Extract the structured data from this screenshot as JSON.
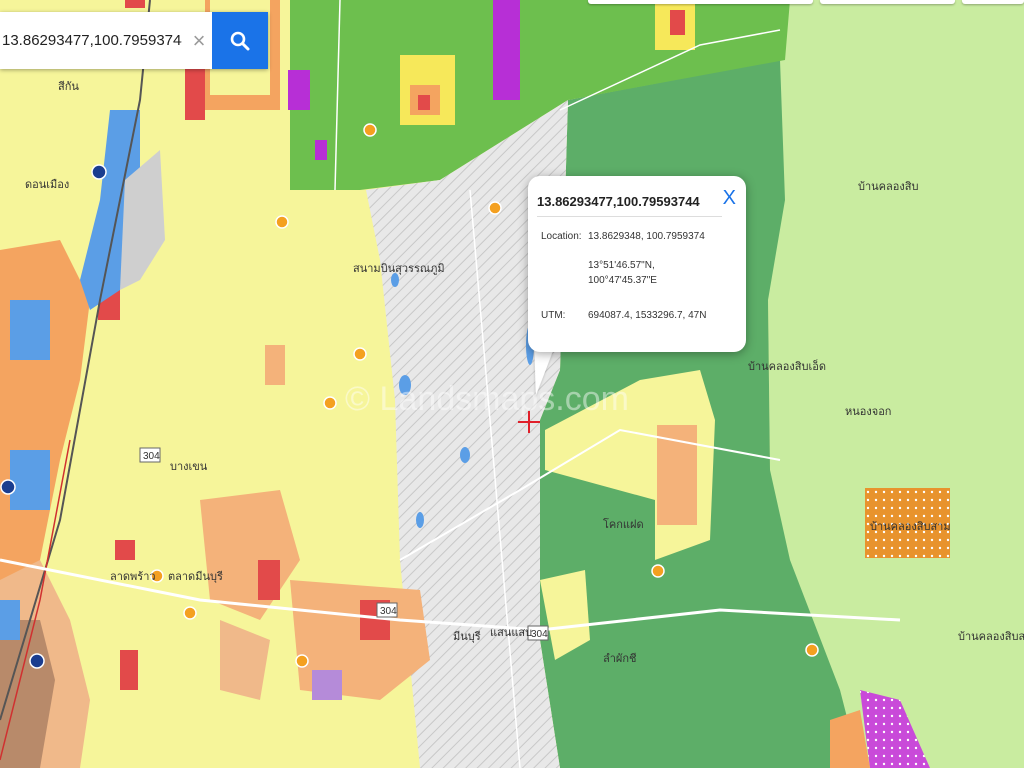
{
  "search": {
    "value": "13.86293477,100.79593744",
    "clear_glyph": "×",
    "search_icon": "search-icon"
  },
  "popup": {
    "title": "13.86293477,100.79593744",
    "close_glyph": "X",
    "location_label": "Location:",
    "location_decimal": "13.8629348, 100.7959374",
    "dms_lat": "13°51'46.57\"N,",
    "dms_lon": "100°47'45.37\"E",
    "utm_label": "UTM:",
    "utm_value": "694087.4, 1533296.7, 47N"
  },
  "map_labels": {
    "place_1": "สีกัน",
    "place_2": "ดอนเมือง",
    "place_3": "สนามบินสุวรรณภูมิ",
    "place_4": "โคกแฝด",
    "place_5": "ลาดพร้าว",
    "place_6": "บางเขน",
    "place_7": "มีนบุรี",
    "place_8": "แสนแสบ",
    "place_9": "หนองจอก",
    "place_10": "ลำผักชี",
    "place_11": "ตลาดมีนบุรี",
    "place_12": "บ้านคลองสิบ",
    "place_13": "บ้านคลองสิบเอ็ด",
    "place_14": "บ้านคลองสิบสาม",
    "place_15": "บ้านคลองสิบสาม",
    "road_304a": "304",
    "road_304b": "304",
    "road_304c": "304",
    "watermark": "© Landsmaps.com"
  },
  "colors": {
    "yellow_zone": "#f6f59a",
    "green_zone": "#6dbf4e",
    "dark_green_zone": "#5dae68",
    "light_green_zone": "#c9eca0",
    "orange_zone": "#f4a460",
    "red_zone": "#e24a4a",
    "purple_zone": "#b72fd6",
    "blue_zone": "#5b9ee6",
    "hatched_zone": "#e6e6e6",
    "search_blue": "#1a73e8"
  }
}
